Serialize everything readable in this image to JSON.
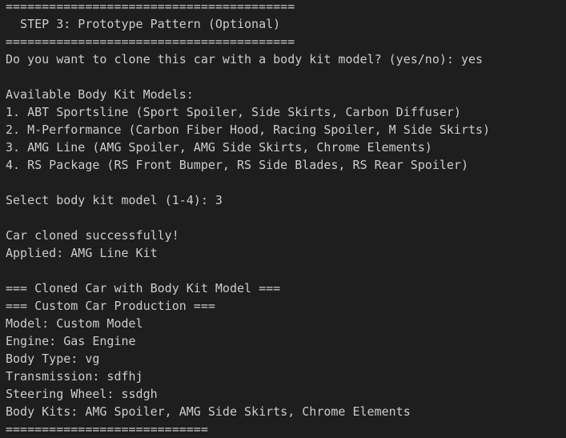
{
  "terminal": {
    "lines": [
      "========================================",
      "  STEP 3: Prototype Pattern (Optional)",
      "========================================",
      "Do you want to clone this car with a body kit model? (yes/no): yes",
      "",
      "Available Body Kit Models:",
      "1. ABT Sportsline (Sport Spoiler, Side Skirts, Carbon Diffuser)",
      "2. M-Performance (Carbon Fiber Hood, Racing Spoiler, M Side Skirts)",
      "3. AMG Line (AMG Spoiler, AMG Side Skirts, Chrome Elements)",
      "4. RS Package (RS Front Bumper, RS Side Blades, RS Rear Spoiler)",
      "",
      "Select body kit model (1-4): 3",
      "",
      "Car cloned successfully!",
      "Applied: AMG Line Kit",
      "",
      "=== Cloned Car with Body Kit Model ===",
      "=== Custom Car Production ===",
      "Model: Custom Model",
      "Engine: Gas Engine",
      "Body Type: vg",
      "Transmission: sdfhj",
      "Steering Wheel: ssdgh",
      "Body Kits: AMG Spoiler, AMG Side Skirts, Chrome Elements",
      "============================"
    ]
  }
}
